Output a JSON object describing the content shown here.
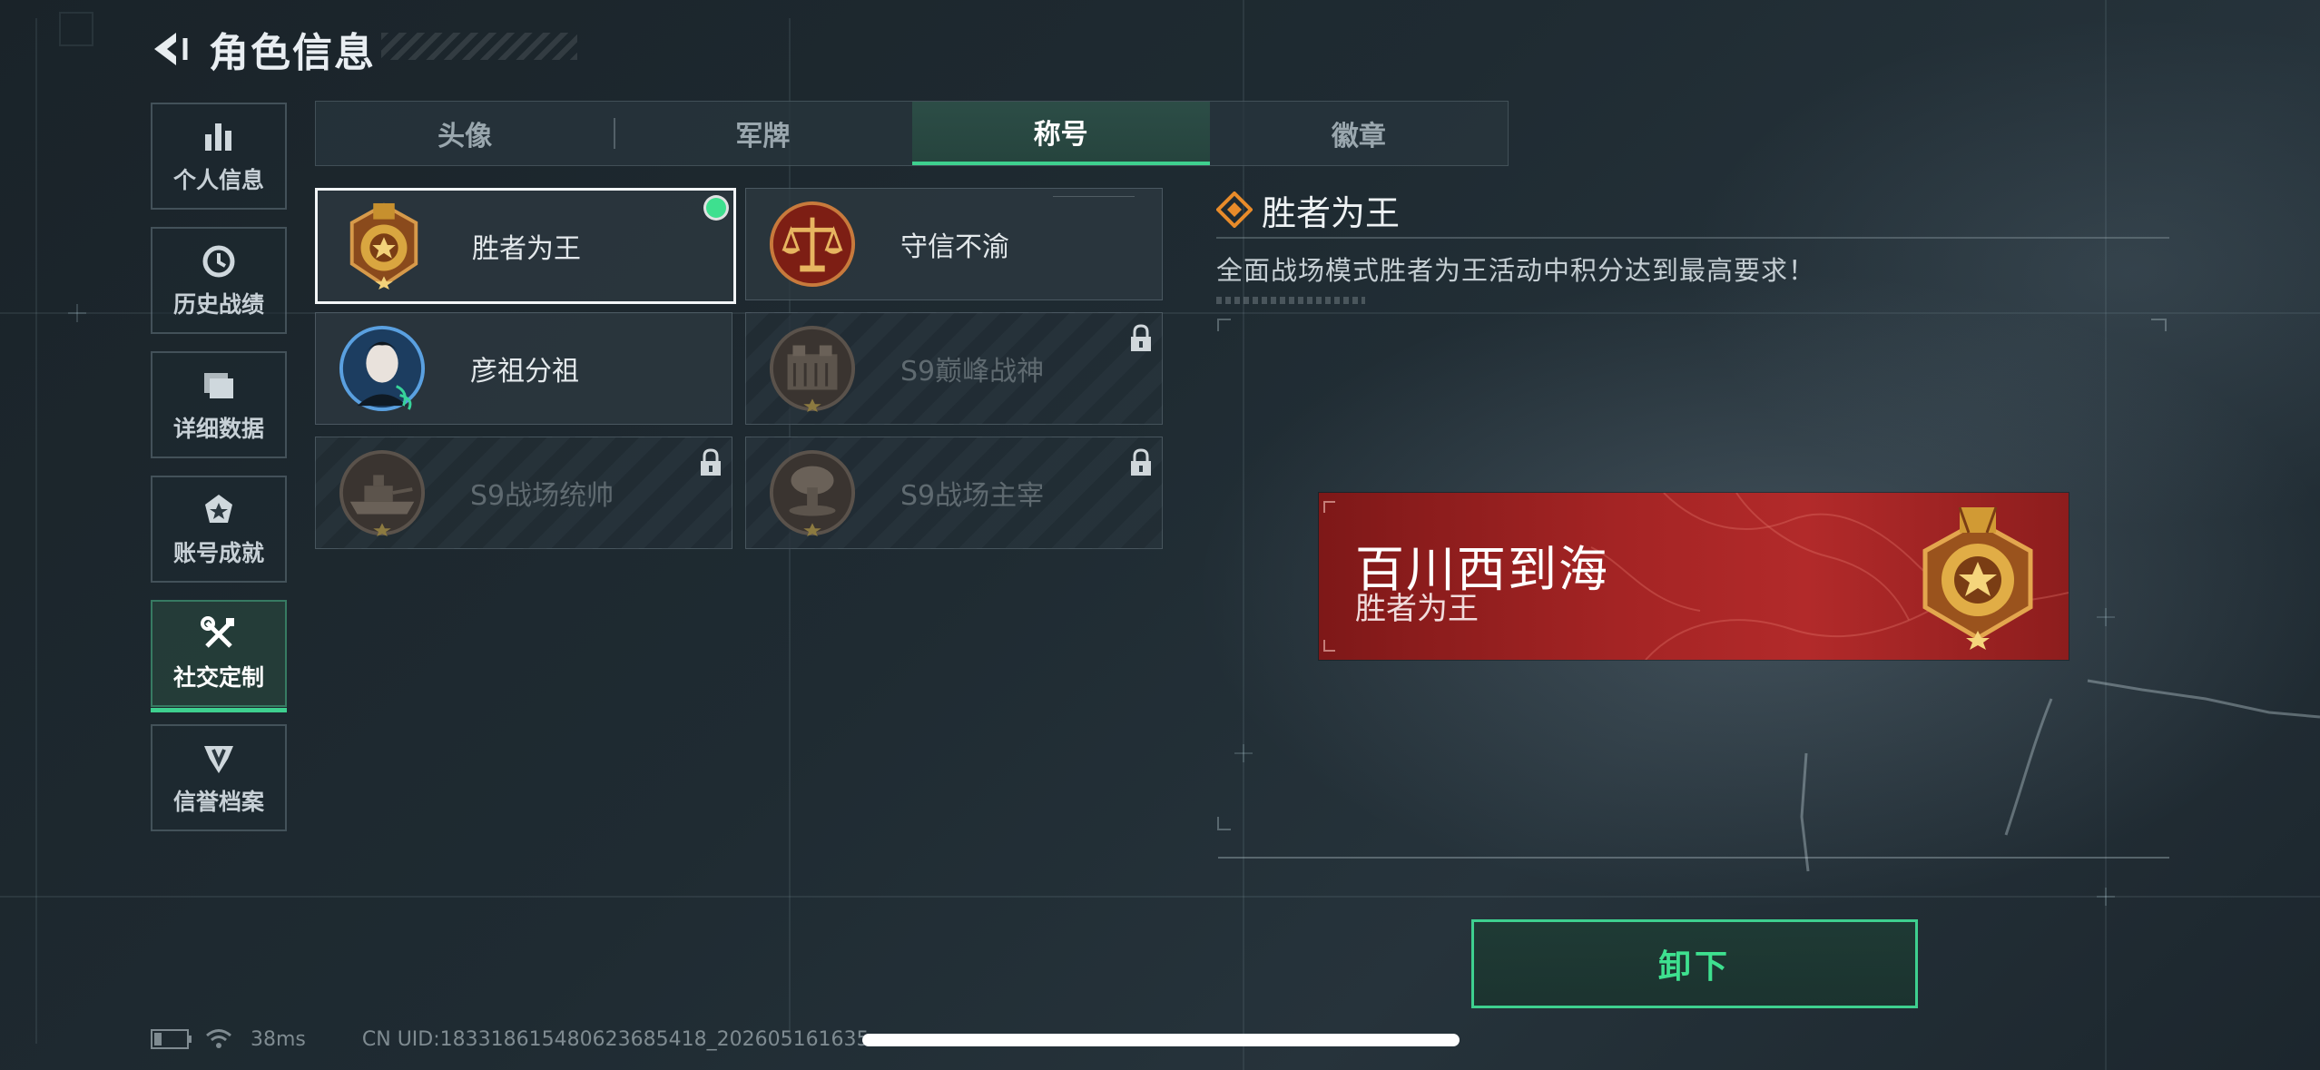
{
  "header": {
    "title": "角色信息"
  },
  "sidebar": {
    "items": [
      {
        "label": "个人信息",
        "icon": "bar-chart-icon"
      },
      {
        "label": "历史战绩",
        "icon": "history-clock-icon"
      },
      {
        "label": "详细数据",
        "icon": "folder-icon"
      },
      {
        "label": "账号成就",
        "icon": "achievement-icon"
      },
      {
        "label": "社交定制",
        "icon": "wrench-tools-icon",
        "active": true
      },
      {
        "label": "信誉档案",
        "icon": "credit-shield-icon"
      }
    ]
  },
  "tabs": [
    {
      "label": "头像"
    },
    {
      "label": "军牌"
    },
    {
      "label": "称号",
      "active": true
    },
    {
      "label": "徽章"
    }
  ],
  "titles": [
    {
      "name": "胜者为王",
      "selected": true,
      "equipped": true,
      "locked": false,
      "emblem": "gold-medal-emblem"
    },
    {
      "name": "守信不渝",
      "selected": false,
      "locked": false,
      "emblem": "scales-of-justice-emblem"
    },
    {
      "name": "彦祖分祖",
      "selected": false,
      "locked": false,
      "emblem": "portrait-emblem"
    },
    {
      "name": "S9巅峰战神",
      "selected": false,
      "locked": true,
      "emblem": "fortress-emblem"
    },
    {
      "name": "S9战场统帅",
      "selected": false,
      "locked": true,
      "emblem": "warship-emblem"
    },
    {
      "name": "S9战场主宰",
      "selected": false,
      "locked": true,
      "emblem": "explosion-emblem"
    }
  ],
  "detail": {
    "title": "胜者为王",
    "description": "全面战场模式胜者为王活动中积分达到最高要求！"
  },
  "banner": {
    "player_name": "百川西到海",
    "title": "胜者为王"
  },
  "unequip_button": {
    "label": "卸下"
  },
  "status_bar": {
    "ping": "38ms",
    "uid": "CN UID:183318615480623685418_202605161635"
  },
  "colors": {
    "accent": "#3ed08f",
    "banner_red": "#a42424",
    "background": "#1f2b32"
  }
}
